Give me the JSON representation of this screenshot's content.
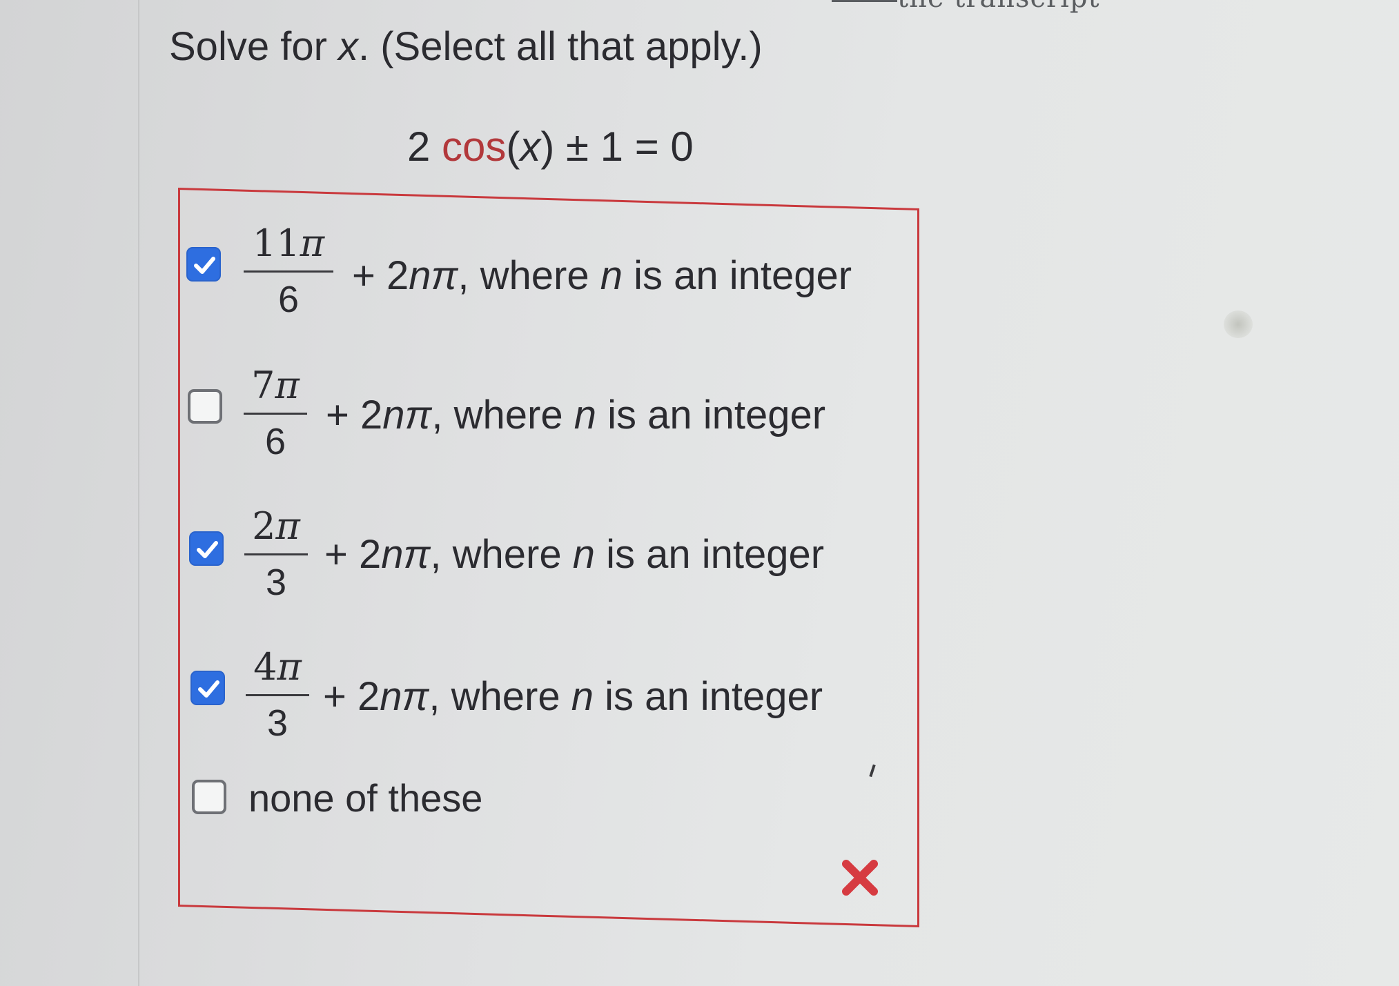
{
  "header_fragment": "the transcript",
  "question": {
    "prefix": "Solve for ",
    "variable": "x",
    "suffix": ". (Select all that apply.)"
  },
  "equation": {
    "coef": "2",
    "fn": "cos",
    "open": "(",
    "arg": "x",
    "close": ")",
    "rest": " ± 1 = 0"
  },
  "options": [
    {
      "checked": true,
      "numerator_digits": "11",
      "pi": "π",
      "denominator": "6",
      "term_prefix": "+ 2",
      "term_n": "n",
      "term_pi": "π",
      "where": ", where ",
      "n": "n",
      "tail": " is an integer"
    },
    {
      "checked": false,
      "numerator_digits": "7",
      "pi": "π",
      "denominator": "6",
      "term_prefix": "+ 2",
      "term_n": "n",
      "term_pi": "π",
      "where": ", where ",
      "n": "n",
      "tail": " is an integer"
    },
    {
      "checked": true,
      "numerator_digits": "2",
      "pi": "π",
      "denominator": "3",
      "term_prefix": "+ 2",
      "term_n": "n",
      "term_pi": "π",
      "where": ", where ",
      "n": "n",
      "tail": " is an integer"
    },
    {
      "checked": true,
      "numerator_digits": "4",
      "pi": "π",
      "denominator": "3",
      "term_prefix": "+ 2",
      "term_n": "n",
      "term_pi": "π",
      "where": ", where ",
      "n": "n",
      "tail": " is an integer"
    }
  ],
  "none_option": {
    "checked": false,
    "label": "none of these"
  },
  "result": {
    "status": "incorrect",
    "icon": "x-mark-icon"
  },
  "colors": {
    "border": "#c9393d",
    "checkbox_checked": "#2e6ee0",
    "wrong_mark": "#d63b41",
    "function_name": "#b2383b"
  }
}
